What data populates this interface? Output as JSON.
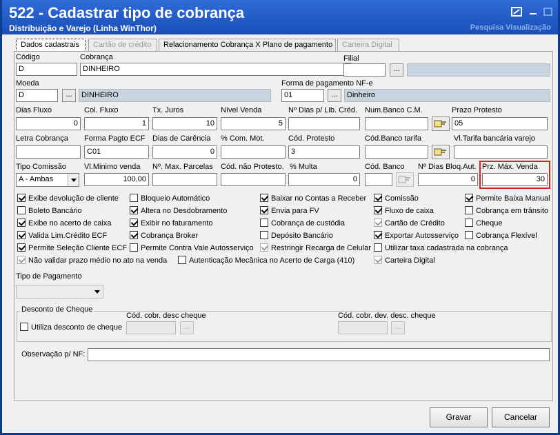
{
  "window": {
    "title": "522 - Cadastrar tipo de cobrança",
    "subtitle": "Distribuição e Varejo (Linha WinThor)",
    "ghost_text": "Pesquisa  Visualização"
  },
  "tabs": [
    {
      "label": "Dados cadastrais",
      "state": "active"
    },
    {
      "label": "Cartão de crédito",
      "state": "disabled"
    },
    {
      "label": "Relacionamento Cobrança X Plano de pagamento",
      "state": "normal"
    },
    {
      "label": "Carteira Digital",
      "state": "disabled"
    }
  ],
  "fields": {
    "codigo": {
      "label": "Código",
      "value": "D"
    },
    "cobranca": {
      "label": "Cobrança",
      "value": "DINHEIRO"
    },
    "filial": {
      "label": "Filial",
      "value": "",
      "desc": ""
    },
    "moeda": {
      "label": "Moeda",
      "value": "D",
      "desc": "DINHEIRO"
    },
    "forma_nfe": {
      "label": "Forma de pagamento NF-e",
      "value": "01",
      "desc": "Dinheiro"
    },
    "dias_fluxo": {
      "label": "Dias Fluxo",
      "value": "0"
    },
    "col_fluxo": {
      "label": "Col. Fluxo",
      "value": "1"
    },
    "tx_juros": {
      "label": "Tx. Juros",
      "value": "10"
    },
    "nivel_venda": {
      "label": "Nível Venda",
      "value": "5"
    },
    "dias_lib_cred": {
      "label": "Nº Dias p/ Lib. Créd.",
      "value": ""
    },
    "num_banco_cm": {
      "label": "Num.Banco C.M.",
      "value": ""
    },
    "prazo_protesto": {
      "label": "Prazo Protesto",
      "value": "05"
    },
    "letra_cobranca": {
      "label": "Letra Cobrança",
      "value": ""
    },
    "forma_pagto_ecf": {
      "label": "Forma Pagto ECF",
      "value": "C01"
    },
    "dias_carencia": {
      "label": "Dias de Carência",
      "value": "0"
    },
    "com_mot": {
      "label": "% Com. Mot.",
      "value": ""
    },
    "cod_protesto": {
      "label": "Cód. Protesto",
      "value": "3"
    },
    "cod_banco_tarifa": {
      "label": "Cód.Banco tarifa",
      "value": ""
    },
    "vl_tarifa": {
      "label": "Vl.Tarifa bancária varejo",
      "value": ""
    },
    "tipo_comissao": {
      "label": "Tipo Comissão",
      "value": "A - Ambas"
    },
    "vl_minimo_venda": {
      "label": "Vl.Minimo venda",
      "value": "100,00"
    },
    "max_parcelas": {
      "label": "Nº. Max. Parcelas",
      "value": ""
    },
    "cod_nao_protesto": {
      "label": "Cód. não Protesto.",
      "value": ""
    },
    "multa": {
      "label": "% Multa",
      "value": "0"
    },
    "cod_banco": {
      "label": "Cód. Banco",
      "value": ""
    },
    "dias_bloq_aut": {
      "label": "Nº Dias Bloq.Aut.",
      "value": "0"
    },
    "prz_max_venda": {
      "label": "Prz. Máx. Venda",
      "value": "30"
    }
  },
  "checkboxes": [
    {
      "label": "Exibe devolução de cliente",
      "checked": true,
      "dim": false
    },
    {
      "label": "Boleto Bancário",
      "checked": false,
      "dim": false
    },
    {
      "label": "Exibe no acerto de caixa",
      "checked": true,
      "dim": false
    },
    {
      "label": "Valida Lim.Crédito ECF",
      "checked": true,
      "dim": false
    },
    {
      "label": "Permite Seleção Cliente ECF",
      "checked": true,
      "dim": false
    },
    {
      "label": "Não validar prazo médio no ato na venda",
      "checked": true,
      "dim": true
    },
    {
      "label": "Bloqueio Automático",
      "checked": false,
      "dim": false
    },
    {
      "label": "Altera no Desdobramento",
      "checked": true,
      "dim": false
    },
    {
      "label": "Exibir no faturamento",
      "checked": true,
      "dim": false
    },
    {
      "label": "Cobrança Broker",
      "checked": true,
      "dim": false
    },
    {
      "label": "Permite Contra Vale Autosserviço",
      "checked": false,
      "dim": false
    },
    {
      "label": "Autenticação Mecânica no Acerto de Carga (410)",
      "checked": false,
      "dim": false
    },
    {
      "label": "Baixar no Contas a Receber",
      "checked": true,
      "dim": false
    },
    {
      "label": "Envia para FV",
      "checked": true,
      "dim": false
    },
    {
      "label": "Cobrança de custódia",
      "checked": false,
      "dim": false
    },
    {
      "label": "Depósito Bancário",
      "checked": false,
      "dim": false
    },
    {
      "label": "Restringir Recarga de Celular",
      "checked": true,
      "dim": true
    },
    {
      "label": "Comissão",
      "checked": true,
      "dim": false
    },
    {
      "label": "Fluxo de caixa",
      "checked": true,
      "dim": false
    },
    {
      "label": "Cartão de Crédito",
      "checked": true,
      "dim": true
    },
    {
      "label": "Exportar Autosserviço",
      "checked": true,
      "dim": false
    },
    {
      "label": "Utilizar taxa cadastrada na cobrança",
      "checked": false,
      "dim": false
    },
    {
      "label": "Carteira Digital",
      "checked": true,
      "dim": true
    },
    {
      "label": "Permite Baixa Manual",
      "checked": true,
      "dim": false
    },
    {
      "label": "Cobrança em trânsito",
      "checked": false,
      "dim": false
    },
    {
      "label": "Cheque",
      "checked": false,
      "dim": false
    },
    {
      "label": "Cobrança Flexível",
      "checked": false,
      "dim": false
    }
  ],
  "tipo_pagamento": {
    "label": "Tipo de Pagamento",
    "value": ""
  },
  "desconto_cheque": {
    "title": "Desconto de Cheque",
    "utiliza_label": "Utiliza desconto de cheque",
    "utiliza_checked": false,
    "cod_cobr_label": "Cód. cobr. desc cheque",
    "cod_cobr_value": "",
    "cod_dev_label": "Cód. cobr. dev. desc. cheque",
    "cod_dev_value": ""
  },
  "observacao": {
    "label": "Observação p/ NF:",
    "value": ""
  },
  "buttons": {
    "dots": "...",
    "gravar": "Gravar",
    "cancelar": "Cancelar"
  }
}
